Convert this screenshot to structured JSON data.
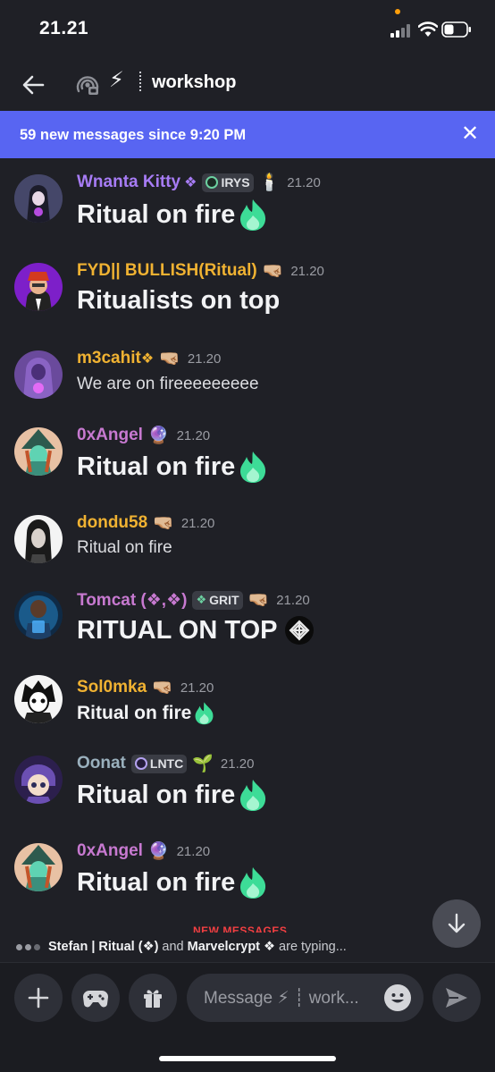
{
  "status": {
    "time": "21.21"
  },
  "header": {
    "channel_emoji": "⚡",
    "channel_name": "workshop"
  },
  "banner": {
    "text": "59 new messages since 9:20 PM",
    "close": "✕"
  },
  "messages": [
    {
      "user": "Wnanta Kitty",
      "user_color": "#a77cf5",
      "sym": "❖",
      "tag": "IRYS",
      "extra": "🕯️",
      "time": "21.20",
      "body": "Ritual on fire",
      "style": "big",
      "flame": true
    },
    {
      "user": "FYD|| BULLISH(Ritual)",
      "user_color": "#f0b232",
      "extra": "🤜🏼",
      "time": "21.20",
      "body": "Ritualists on top",
      "style": "big",
      "flame": false
    },
    {
      "user": "m3cahit",
      "user_color": "#f0b232",
      "sym": "❖",
      "extra": "🤜🏼",
      "time": "21.20",
      "body": "We are on fireeeeeeeee",
      "style": "norm",
      "flame": false
    },
    {
      "user": "0xAngel",
      "user_color": "#c779d0",
      "extra": "🔮",
      "time": "21.20",
      "body": "Ritual on fire",
      "style": "big",
      "flame": true
    },
    {
      "user": "dondu58",
      "user_color": "#f0b232",
      "extra": "🤜🏼",
      "time": "21.20",
      "body": "Ritual on fire",
      "style": "norm",
      "flame": false
    },
    {
      "user": "Tomcat (❖,❖)",
      "user_color": "#c779d0",
      "tag": "GRIT",
      "extra": "🤜🏼",
      "time": "21.20",
      "body": "RITUAL ON TOP",
      "style": "big",
      "flame": false,
      "knot": true
    },
    {
      "user": "Sol0mka",
      "user_color": "#f0b232",
      "extra": "🤜🏼",
      "time": "21.20",
      "body": "Ritual on fire",
      "style": "med",
      "flame": true
    },
    {
      "user": "Oonat",
      "user_color": "#9ab0bd",
      "tag": "LNTC",
      "extra": "🌱",
      "time": "21.20",
      "body": "Ritual on fire",
      "style": "big",
      "flame": true
    },
    {
      "user": "0xAngel",
      "user_color": "#c779d0",
      "extra": "🔮",
      "time": "21.20",
      "body": "Ritual on fire",
      "style": "big",
      "flame": true
    }
  ],
  "new_messages_label": "NEW MESSAGES",
  "typing": {
    "user1": "Stefan | Ritual (❖)",
    "joiner": "and",
    "user2": "Marvelcrypt ❖",
    "suffix": "are typing..."
  },
  "composer": {
    "placeholder": "Message ⚡ ┊ work..."
  },
  "colors": {
    "accent": "#5865f2",
    "background": "#1f2026",
    "flame": "#3ddc97"
  }
}
